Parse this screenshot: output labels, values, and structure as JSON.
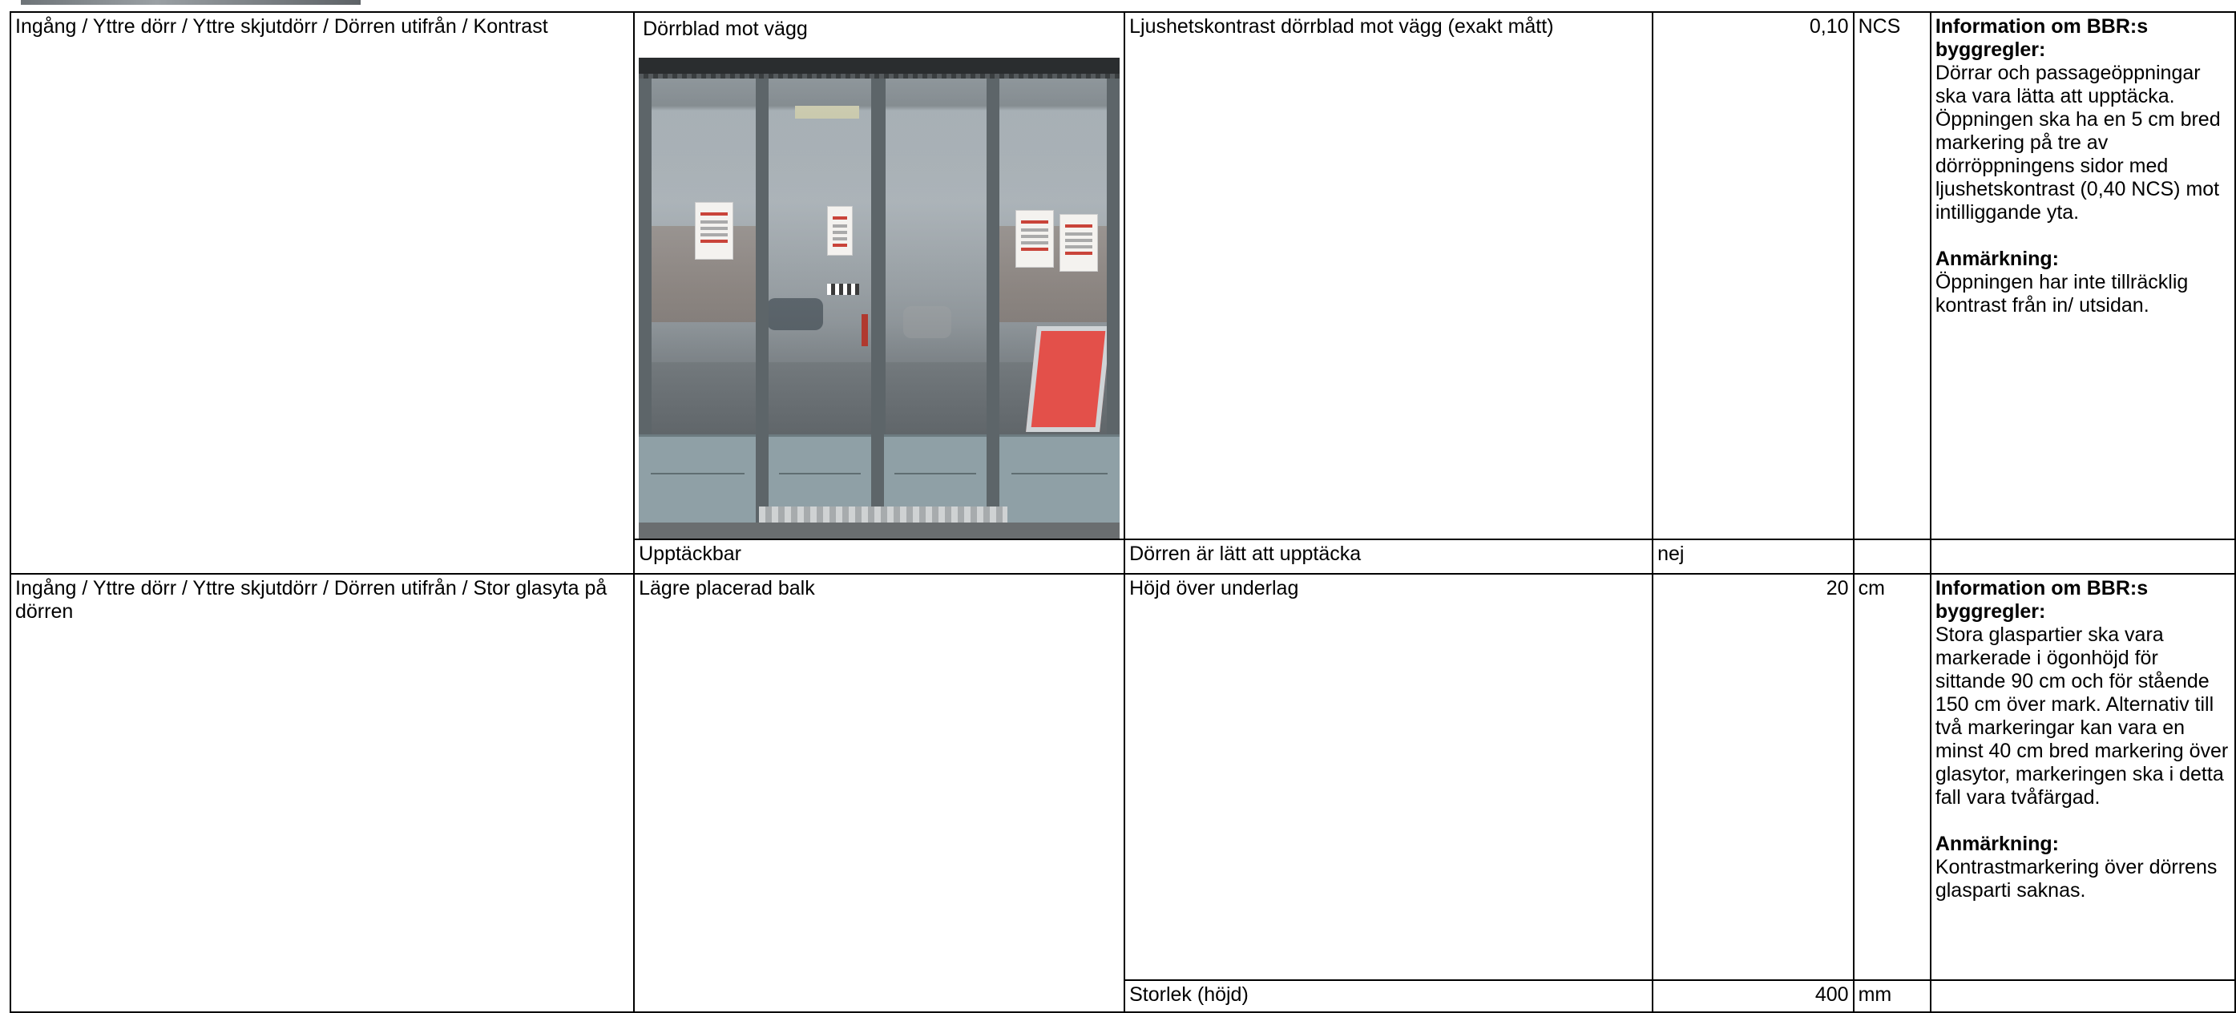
{
  "rows": [
    {
      "path": "Ingång / Yttre dörr / Yttre skjutdörr  / Dörren utifrån / Kontrast",
      "item_label": "Dörrblad mot vägg",
      "item_label_2": "Upptäckbar",
      "photo_icon": "door-photo",
      "measurements": [
        {
          "label": "Ljushetskontrast dörrblad mot vägg (exakt mått)",
          "value": "0,10",
          "unit": "NCS"
        },
        {
          "label": "Dörren är lätt att upptäcka",
          "value": "nej",
          "unit": ""
        }
      ],
      "info": {
        "heading": "Information om BBR:s byggregler:",
        "text": "Dörrar och passageöppningar ska vara lätta att upptäcka. Öppningen ska ha en 5 cm bred markering på tre av dörröppningens sidor med ljushetskontrast (0,40 NCS) mot intilliggande yta.",
        "remark_heading": "Anmärkning:",
        "remark_text": "Öppningen har inte tillräcklig kontrast från in/ utsidan."
      }
    },
    {
      "path": "Ingång / Yttre dörr / Yttre skjutdörr  / Dörren utifrån / Stor glasyta på dörren",
      "item_label": "Lägre placerad balk",
      "measurements": [
        {
          "label": "Höjd över underlag",
          "value": "20",
          "unit": "cm"
        },
        {
          "label": "Storlek (höjd)",
          "value": "400",
          "unit": "mm"
        }
      ],
      "info": {
        "heading": "Information om BBR:s byggregler:",
        "text": "Stora glaspartier ska vara markerade i ögonhöjd för sittande 90 cm och för stående 150 cm över mark. Alternativ till två markeringar kan vara en minst 40 cm bred markering över glasytor, markeringen ska i detta fall vara tvåfärgad.",
        "remark_heading": "Anmärkning:",
        "remark_text": "Kontrastmarkering över dörrens glasparti saknas."
      }
    }
  ]
}
